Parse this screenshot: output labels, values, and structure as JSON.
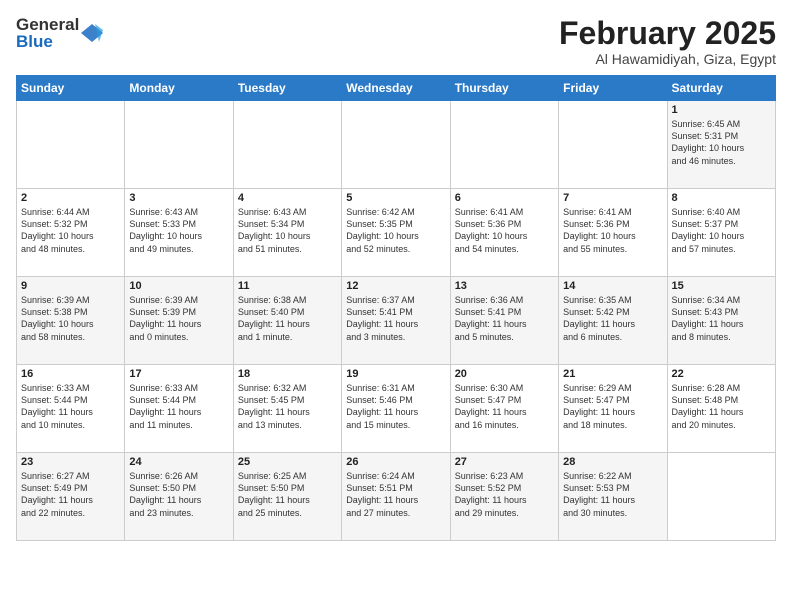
{
  "logo": {
    "general": "General",
    "blue": "Blue"
  },
  "title": "February 2025",
  "location": "Al Hawamidiyah, Giza, Egypt",
  "days": [
    "Sunday",
    "Monday",
    "Tuesday",
    "Wednesday",
    "Thursday",
    "Friday",
    "Saturday"
  ],
  "weeks": [
    [
      {
        "day": "",
        "content": ""
      },
      {
        "day": "",
        "content": ""
      },
      {
        "day": "",
        "content": ""
      },
      {
        "day": "",
        "content": ""
      },
      {
        "day": "",
        "content": ""
      },
      {
        "day": "",
        "content": ""
      },
      {
        "day": "1",
        "content": "Sunrise: 6:45 AM\nSunset: 5:31 PM\nDaylight: 10 hours\nand 46 minutes."
      }
    ],
    [
      {
        "day": "2",
        "content": "Sunrise: 6:44 AM\nSunset: 5:32 PM\nDaylight: 10 hours\nand 48 minutes."
      },
      {
        "day": "3",
        "content": "Sunrise: 6:43 AM\nSunset: 5:33 PM\nDaylight: 10 hours\nand 49 minutes."
      },
      {
        "day": "4",
        "content": "Sunrise: 6:43 AM\nSunset: 5:34 PM\nDaylight: 10 hours\nand 51 minutes."
      },
      {
        "day": "5",
        "content": "Sunrise: 6:42 AM\nSunset: 5:35 PM\nDaylight: 10 hours\nand 52 minutes."
      },
      {
        "day": "6",
        "content": "Sunrise: 6:41 AM\nSunset: 5:36 PM\nDaylight: 10 hours\nand 54 minutes."
      },
      {
        "day": "7",
        "content": "Sunrise: 6:41 AM\nSunset: 5:36 PM\nDaylight: 10 hours\nand 55 minutes."
      },
      {
        "day": "8",
        "content": "Sunrise: 6:40 AM\nSunset: 5:37 PM\nDaylight: 10 hours\nand 57 minutes."
      }
    ],
    [
      {
        "day": "9",
        "content": "Sunrise: 6:39 AM\nSunset: 5:38 PM\nDaylight: 10 hours\nand 58 minutes."
      },
      {
        "day": "10",
        "content": "Sunrise: 6:39 AM\nSunset: 5:39 PM\nDaylight: 11 hours\nand 0 minutes."
      },
      {
        "day": "11",
        "content": "Sunrise: 6:38 AM\nSunset: 5:40 PM\nDaylight: 11 hours\nand 1 minute."
      },
      {
        "day": "12",
        "content": "Sunrise: 6:37 AM\nSunset: 5:41 PM\nDaylight: 11 hours\nand 3 minutes."
      },
      {
        "day": "13",
        "content": "Sunrise: 6:36 AM\nSunset: 5:41 PM\nDaylight: 11 hours\nand 5 minutes."
      },
      {
        "day": "14",
        "content": "Sunrise: 6:35 AM\nSunset: 5:42 PM\nDaylight: 11 hours\nand 6 minutes."
      },
      {
        "day": "15",
        "content": "Sunrise: 6:34 AM\nSunset: 5:43 PM\nDaylight: 11 hours\nand 8 minutes."
      }
    ],
    [
      {
        "day": "16",
        "content": "Sunrise: 6:33 AM\nSunset: 5:44 PM\nDaylight: 11 hours\nand 10 minutes."
      },
      {
        "day": "17",
        "content": "Sunrise: 6:33 AM\nSunset: 5:44 PM\nDaylight: 11 hours\nand 11 minutes."
      },
      {
        "day": "18",
        "content": "Sunrise: 6:32 AM\nSunset: 5:45 PM\nDaylight: 11 hours\nand 13 minutes."
      },
      {
        "day": "19",
        "content": "Sunrise: 6:31 AM\nSunset: 5:46 PM\nDaylight: 11 hours\nand 15 minutes."
      },
      {
        "day": "20",
        "content": "Sunrise: 6:30 AM\nSunset: 5:47 PM\nDaylight: 11 hours\nand 16 minutes."
      },
      {
        "day": "21",
        "content": "Sunrise: 6:29 AM\nSunset: 5:47 PM\nDaylight: 11 hours\nand 18 minutes."
      },
      {
        "day": "22",
        "content": "Sunrise: 6:28 AM\nSunset: 5:48 PM\nDaylight: 11 hours\nand 20 minutes."
      }
    ],
    [
      {
        "day": "23",
        "content": "Sunrise: 6:27 AM\nSunset: 5:49 PM\nDaylight: 11 hours\nand 22 minutes."
      },
      {
        "day": "24",
        "content": "Sunrise: 6:26 AM\nSunset: 5:50 PM\nDaylight: 11 hours\nand 23 minutes."
      },
      {
        "day": "25",
        "content": "Sunrise: 6:25 AM\nSunset: 5:50 PM\nDaylight: 11 hours\nand 25 minutes."
      },
      {
        "day": "26",
        "content": "Sunrise: 6:24 AM\nSunset: 5:51 PM\nDaylight: 11 hours\nand 27 minutes."
      },
      {
        "day": "27",
        "content": "Sunrise: 6:23 AM\nSunset: 5:52 PM\nDaylight: 11 hours\nand 29 minutes."
      },
      {
        "day": "28",
        "content": "Sunrise: 6:22 AM\nSunset: 5:53 PM\nDaylight: 11 hours\nand 30 minutes."
      },
      {
        "day": "",
        "content": ""
      }
    ]
  ]
}
